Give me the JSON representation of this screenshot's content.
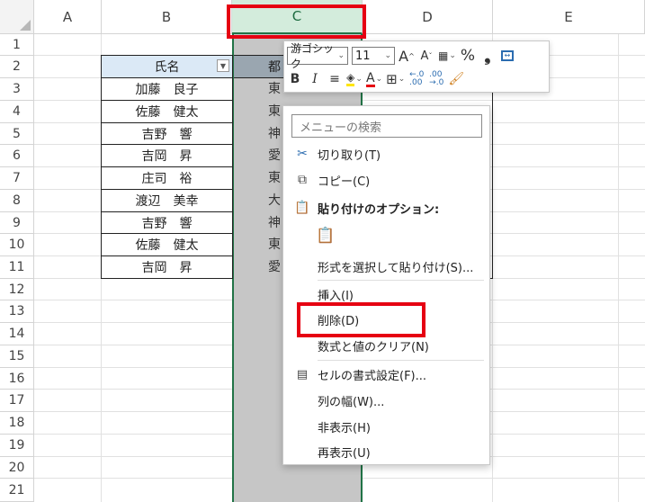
{
  "columns": [
    "A",
    "B",
    "C",
    "D",
    "E"
  ],
  "rows": [
    "1",
    "2",
    "3",
    "4",
    "5",
    "6",
    "7",
    "8",
    "9",
    "10",
    "11",
    "12",
    "13",
    "14",
    "15",
    "16",
    "17",
    "18",
    "19",
    "20",
    "21"
  ],
  "table": {
    "header_b": "氏名",
    "header_c": "都",
    "names": [
      "加藤　良子",
      "佐藤　健太",
      "吉野　響",
      "吉岡　昇",
      "庄司　裕",
      "渡辺　美幸",
      "吉野　響",
      "佐藤　健太",
      "吉岡　昇"
    ],
    "col_c_partial": [
      "東",
      "東",
      "神",
      "愛",
      "東",
      "大",
      "神",
      "東",
      "愛"
    ]
  },
  "mini_toolbar": {
    "font_name": "游ゴシック",
    "font_size": "11",
    "increase_font": "A",
    "decrease_font": "A",
    "percent": "%",
    "comma": "❟",
    "bold": "B",
    "italic": "I",
    "align": "≡",
    "font_color": "A",
    "inc_decimal": ".00→.0",
    "dec_decimal": ".0→.00"
  },
  "context_menu": {
    "search_placeholder": "メニューの検索",
    "items": {
      "cut": "切り取り(T)",
      "copy": "コピー(C)",
      "paste_options": "貼り付けのオプション:",
      "paste_special": "形式を選択して貼り付け(S)...",
      "insert": "挿入(I)",
      "delete": "削除(D)",
      "clear_contents": "数式と値のクリア(N)",
      "format_cells": "セルの書式設定(F)...",
      "column_width": "列の幅(W)...",
      "hide": "非表示(H)",
      "unhide": "再表示(U)"
    }
  },
  "colors": {
    "selected_header": "#d3ecdc",
    "selected_column": "#c6c6c6",
    "accent_green": "#217346",
    "highlight_red": "#e60012",
    "table_header_blue": "#dbe9f6"
  }
}
